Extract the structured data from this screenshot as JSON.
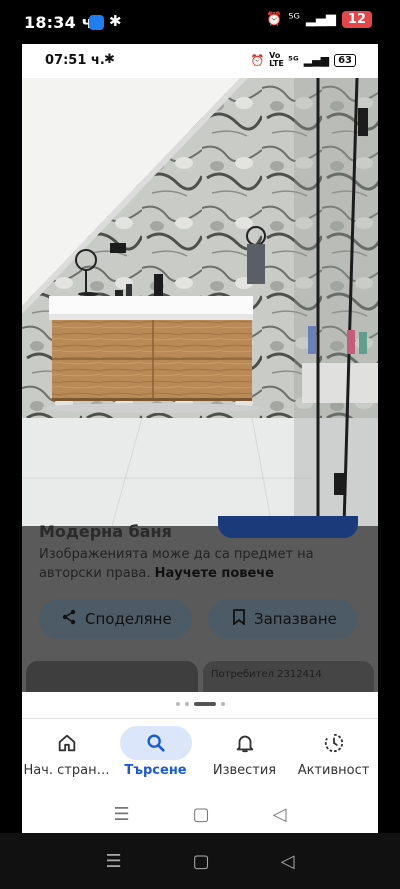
{
  "outer_status": {
    "time": "18:34 ч.",
    "network": "⁵ᴳ",
    "battery": "12"
  },
  "inner_status": {
    "time": "07:51 ч.",
    "volte": "Vo LTE",
    "network": "⁵ᴳ",
    "battery": "63"
  },
  "detail": {
    "title": "Модерна баня",
    "description": "Изображенията може да са предмет на авторски права.",
    "learn_more": "Научете повече",
    "share_label": "Споделяне",
    "save_label": "Запазване",
    "card_author": "Потребител 2312414"
  },
  "carousel": {
    "count": 4,
    "active_index": 2
  },
  "tabs": [
    {
      "label": "Нач. стран…",
      "icon": "home-icon"
    },
    {
      "label": "Търсене",
      "icon": "search-icon",
      "active": true
    },
    {
      "label": "Известия",
      "icon": "bell-icon"
    },
    {
      "label": "Активност",
      "icon": "activity-icon"
    }
  ],
  "colors": {
    "accent": "#1a5bd8",
    "active_tab_bg": "#dce6fa",
    "battery_low": "#e6454a"
  }
}
